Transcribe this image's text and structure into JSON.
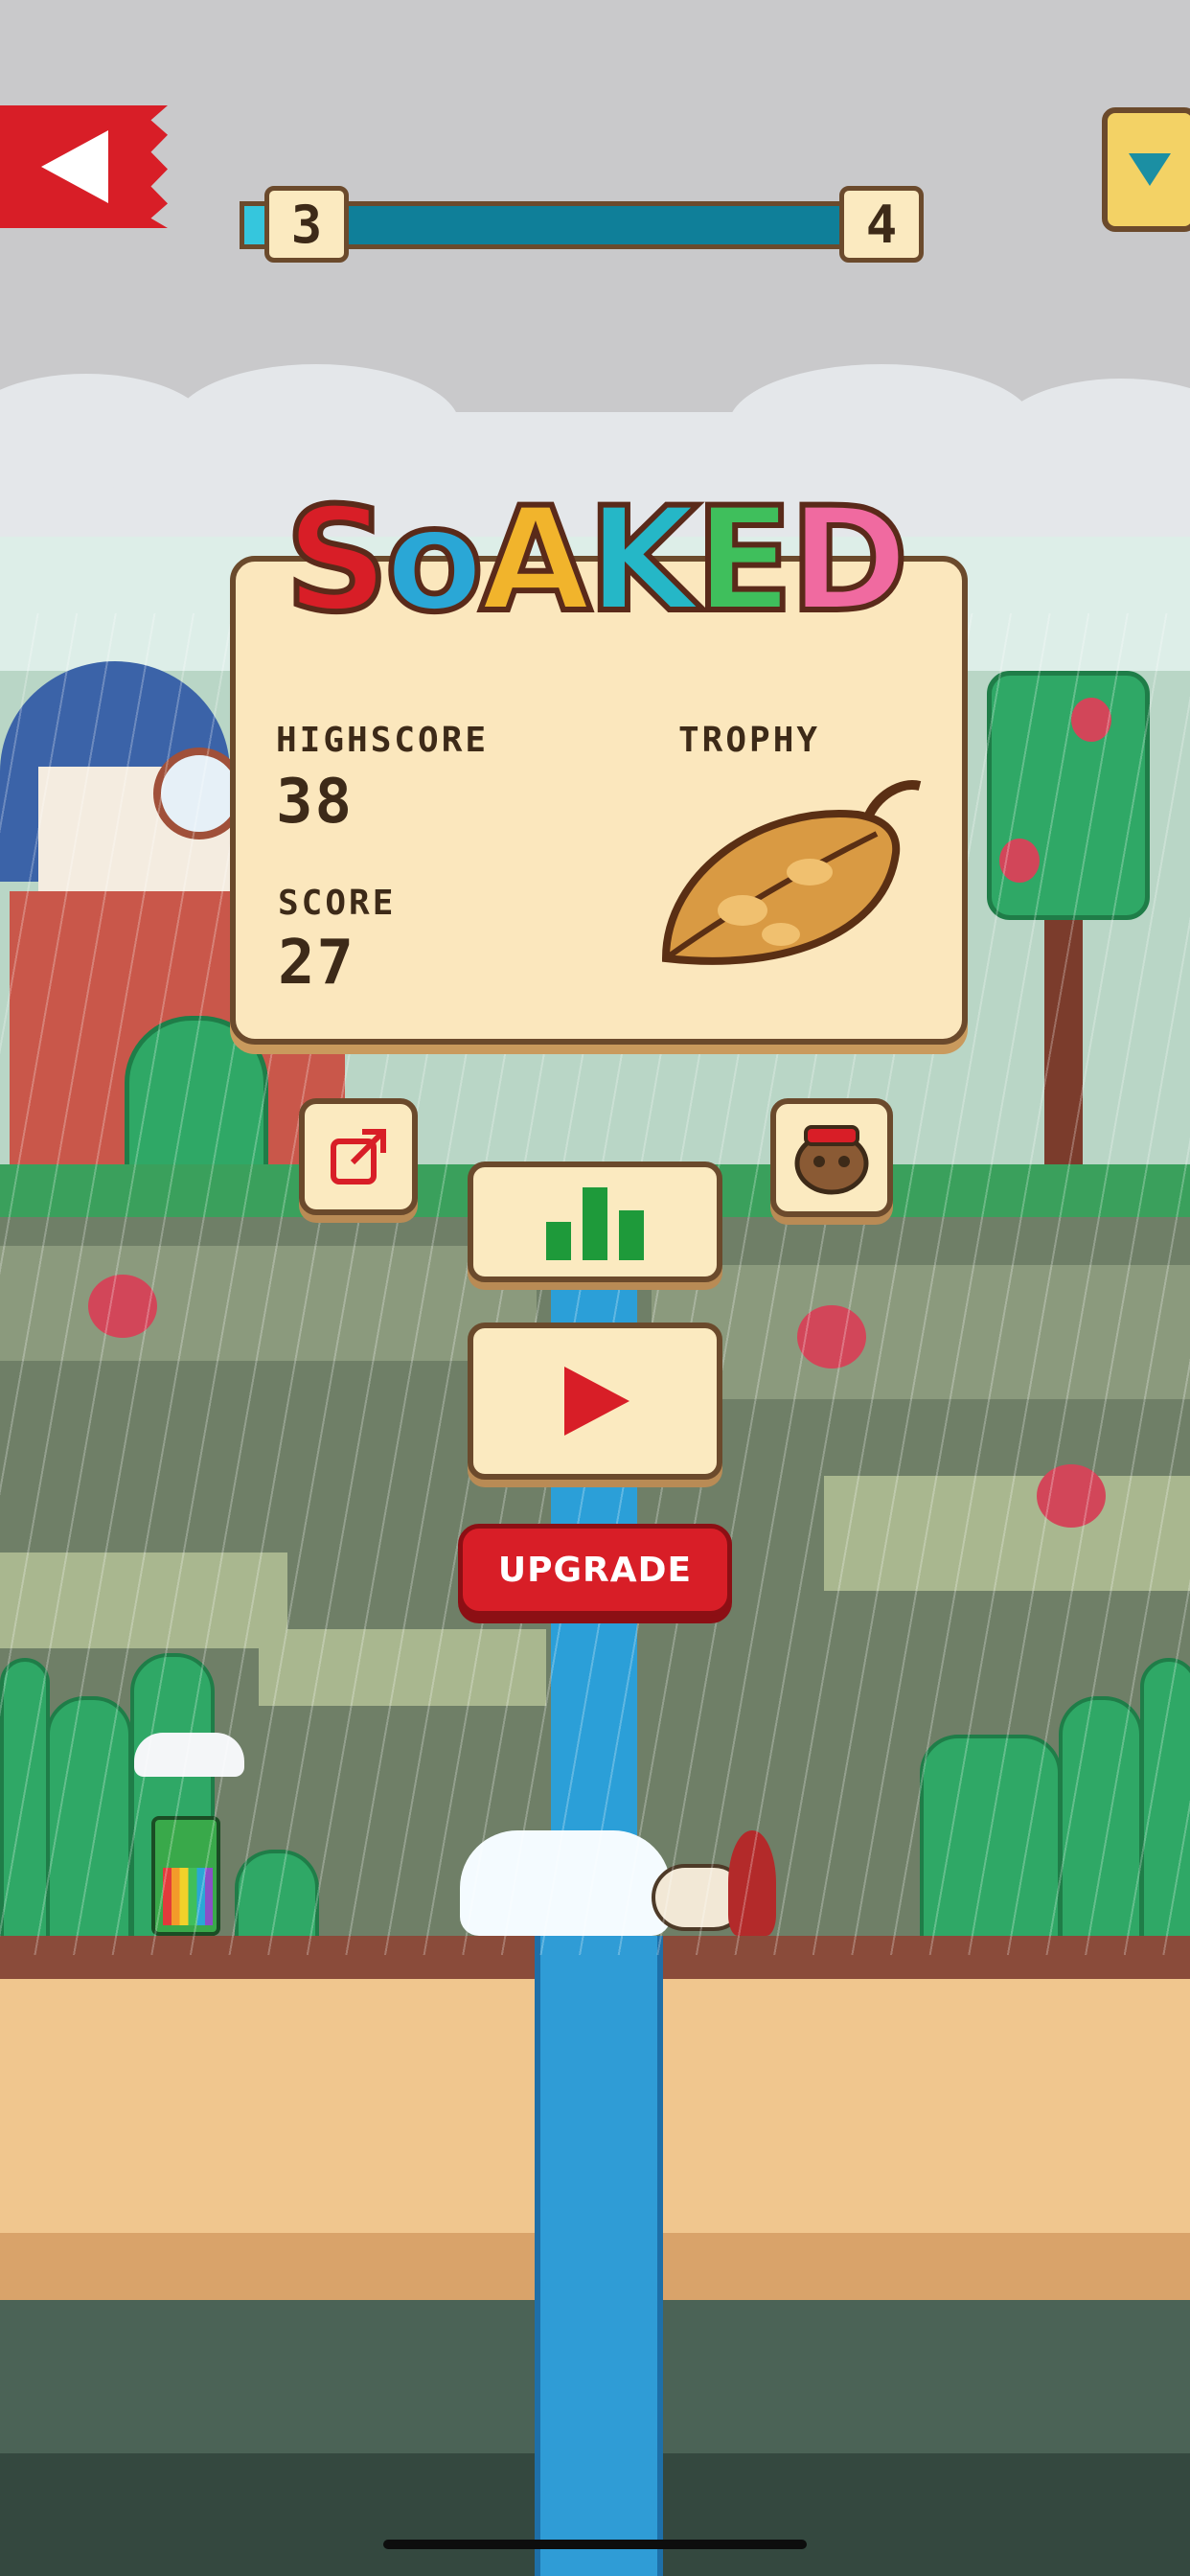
{
  "game": {
    "title_letters": [
      "S",
      "o",
      "A",
      "K",
      "E",
      "D"
    ],
    "title_colors": [
      "#d81e27",
      "#2aa7d6",
      "#f1b42c",
      "#25b7c7",
      "#3fbf5c",
      "#f06aa0"
    ]
  },
  "level": {
    "current": "3",
    "next": "4",
    "progress_percent": 12
  },
  "panel": {
    "highscore_label": "HIGHSCORE",
    "highscore_value": "38",
    "score_label": "SCORE",
    "score_value": "27",
    "trophy_label": "TROPHY"
  },
  "buttons": {
    "upgrade_label": "UPGRADE"
  },
  "icons": {
    "back": "back-arrow-icon",
    "medal": "medal-icon",
    "share": "share-icon",
    "leaderboard": "leaderboard-icon",
    "play": "play-icon",
    "character": "character-select-icon",
    "trophy": "leaf-trophy-icon"
  },
  "colors": {
    "accent_red": "#d81e27",
    "panel_bg": "#fbe7bd",
    "outline": "#6b4a2c",
    "leaderboard_green": "#1e9a3a"
  }
}
